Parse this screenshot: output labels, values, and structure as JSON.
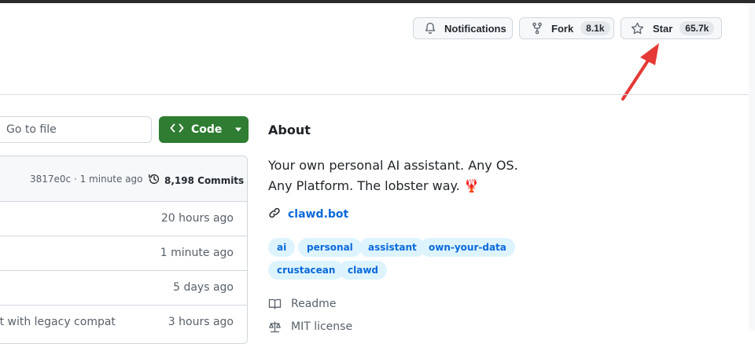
{
  "header": {
    "notifications": {
      "label": "Notifications",
      "icon": "bell-icon"
    },
    "fork": {
      "label": "Fork",
      "count": "8.1k",
      "icon": "fork-icon"
    },
    "star": {
      "label": "Star",
      "count": "65.7k",
      "icon": "star-icon"
    },
    "annotation_color": "#e53935"
  },
  "files": {
    "search_placeholder": "Go to file",
    "code_button": "Code",
    "commit_info": "3817e0c · 1 minute ago",
    "commits_label": "8,198 Commits",
    "rows": [
      {
        "message": "",
        "age": "20 hours ago"
      },
      {
        "message": "",
        "age": "1 minute ago"
      },
      {
        "message": "",
        "age": "5 days ago"
      },
      {
        "message": "ot with legacy compat",
        "age": "3 hours ago"
      }
    ]
  },
  "about": {
    "title": "About",
    "description_line1": "Your own personal AI assistant. Any OS.",
    "description_line2": "Any Platform. The lobster way. 🦞",
    "website": "clawd.bot",
    "topics": [
      "ai",
      "personal",
      "assistant",
      "own-your-data",
      "crustacean",
      "clawd"
    ],
    "readme": "Readme",
    "license": "MIT license",
    "accent_color": "#0969da",
    "code_button_color": "#2e7d32"
  }
}
